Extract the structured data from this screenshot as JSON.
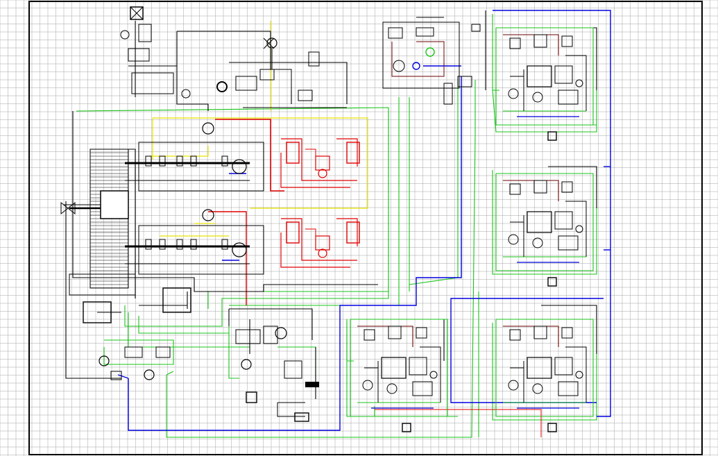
{
  "drawing": {
    "kind": "engineering schematic drawing (CAD sheet)",
    "background": "#ffffff",
    "grid_color": "#9a9a9a",
    "line_colors": {
      "black": "#000000",
      "green": "#18c418",
      "yellow": "#e8e200",
      "red": "#e00000",
      "blue": "#0000e0",
      "dark_red": "#6b0000"
    },
    "groups": [
      {
        "name": "top-left-feed-assembly",
        "color": "#000000"
      },
      {
        "name": "top-center-valve-train",
        "color": "#000000"
      },
      {
        "name": "main-driveline-block",
        "color": "#000000"
      },
      {
        "name": "yellow-signal-loop-upper",
        "color": "#e8e200"
      },
      {
        "name": "red-hydraulic-circuit-upper",
        "color": "#e00000"
      },
      {
        "name": "red-hydraulic-circuit-lower",
        "color": "#e00000"
      },
      {
        "name": "top-control-panel",
        "color": "#000000"
      },
      {
        "name": "right-unit-1",
        "color": "#000000"
      },
      {
        "name": "right-unit-2",
        "color": "#000000"
      },
      {
        "name": "bottom-unit-left",
        "color": "#000000"
      },
      {
        "name": "bottom-unit-right",
        "color": "#000000"
      },
      {
        "name": "bottom-center-pump-station",
        "color": "#000000"
      },
      {
        "name": "bottom-left-gauge-cluster",
        "color": "#000000"
      },
      {
        "name": "green-interconnect-lines",
        "color": "#18c418"
      },
      {
        "name": "blue-return-lines",
        "color": "#0000e0"
      }
    ]
  }
}
